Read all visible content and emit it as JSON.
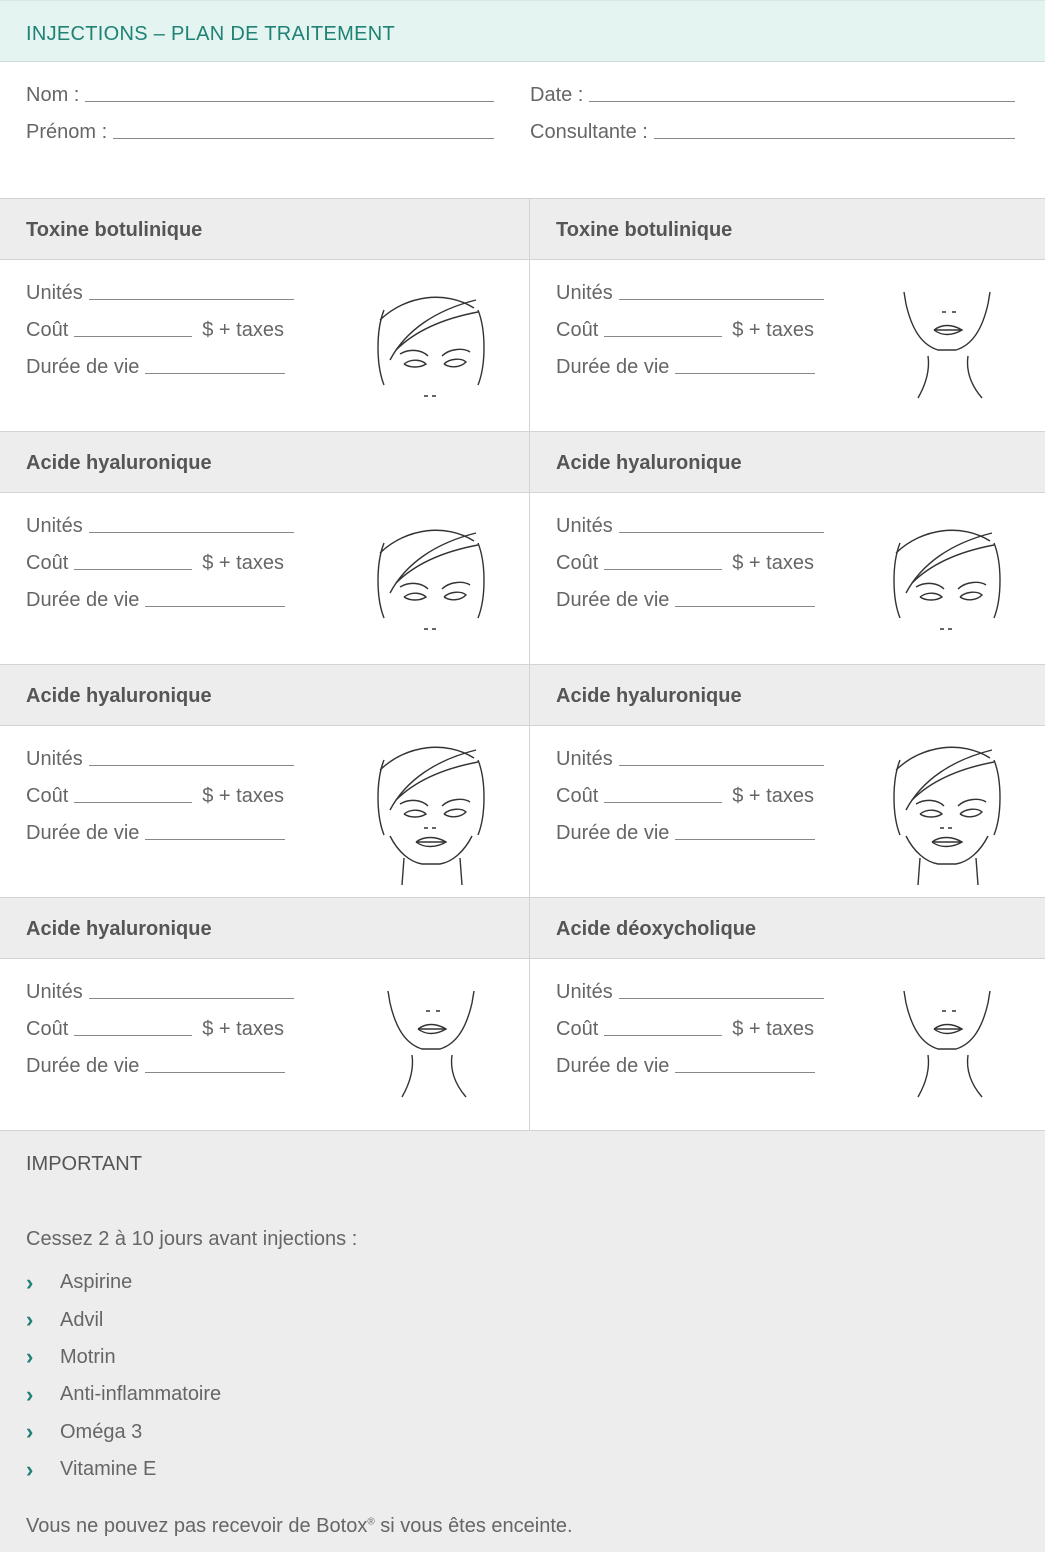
{
  "header": {
    "title": "INJECTIONS – PLAN DE TRAITEMENT"
  },
  "patient": {
    "nom_label": "Nom :",
    "prenom_label": "Prénom :",
    "date_label": "Date :",
    "consultante_label": "Consultante :"
  },
  "fields": {
    "units_label": "Unités",
    "cost_label": "Coût",
    "cost_suffix": "$ + taxes",
    "lifespan_label": "Durée de vie"
  },
  "sections": [
    {
      "title": "Toxine botulinique",
      "face": "upper-face-icon"
    },
    {
      "title": "Toxine botulinique",
      "face": "lower-face-icon"
    },
    {
      "title": "Acide hyaluronique",
      "face": "upper-face-icon"
    },
    {
      "title": "Acide hyaluronique",
      "face": "upper-face-icon"
    },
    {
      "title": "Acide hyaluronique",
      "face": "full-face-icon"
    },
    {
      "title": "Acide hyaluronique",
      "face": "full-face-icon"
    },
    {
      "title": "Acide hyaluronique",
      "face": "lower-face-icon"
    },
    {
      "title": "Acide déoxycholique",
      "face": "lower-face-icon"
    }
  ],
  "important": {
    "title": "IMPORTANT",
    "intro": "Cessez 2 à 10 jours avant injections :",
    "items": [
      "Aspirine",
      "Advil",
      "Motrin",
      "Anti-inflammatoire",
      "Oméga 3",
      "Vitamine E"
    ],
    "footer_before": "Vous ne pouvez pas recevoir de Botox",
    "footer_mark": "®",
    "footer_after": " si vous êtes enceinte."
  },
  "colors": {
    "accent": "#1f8274",
    "title_bg": "#e3f4f1",
    "section_bg": "#ededed"
  }
}
